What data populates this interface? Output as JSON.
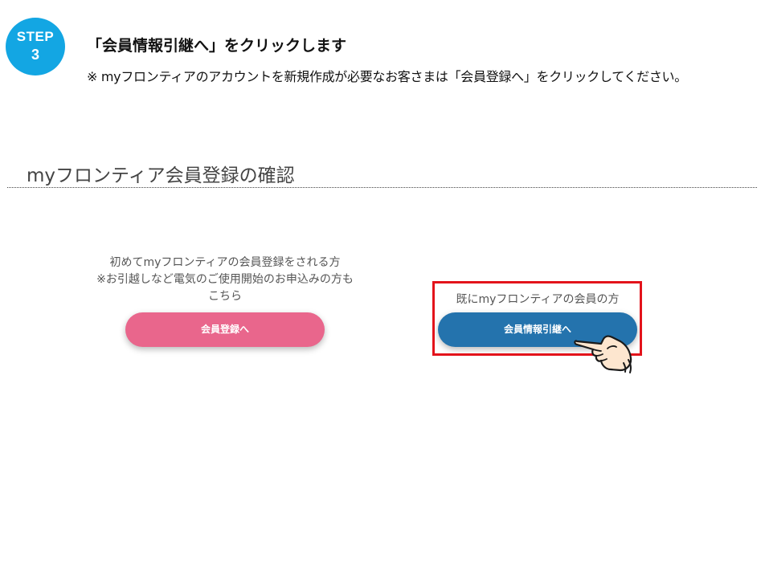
{
  "step": {
    "word": "STEP",
    "number": "3",
    "color": "#13a6e3"
  },
  "instruction": {
    "title": "「会員情報引継へ」をクリックします",
    "note": "※ myフロンティアのアカウントを新規作成が必要なお客さまは「会員登録へ」をクリックしてください。"
  },
  "section": {
    "title": "myフロンティア会員登録の確認"
  },
  "left_option": {
    "description_lines": [
      "初めてmyフロンティアの会員登録をされる方",
      "※お引越しなど電気のご使用開始のお申込みの方も",
      "こちら"
    ],
    "button_label": "会員登録へ",
    "button_color": "#e9668c"
  },
  "right_option": {
    "description": "既にmyフロンティアの会員の方",
    "button_label": "会員情報引継へ",
    "button_color": "#2473ad",
    "highlight_color": "#e3131b",
    "pointer_icon": "pointing-hand-icon"
  }
}
